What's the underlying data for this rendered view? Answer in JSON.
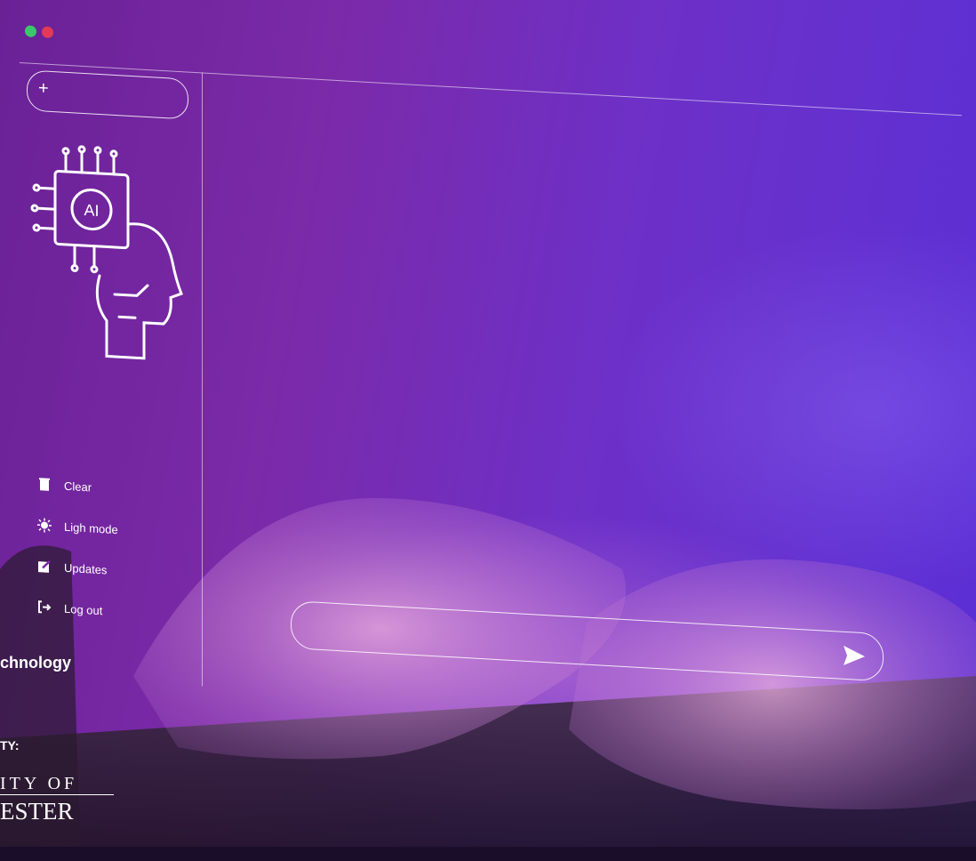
{
  "window": {
    "controls": [
      "green-dot",
      "red-dot"
    ],
    "new_chat_label": "+"
  },
  "sidebar": {
    "items": [
      {
        "label": "Clear",
        "icon": "trash-icon"
      },
      {
        "label": "Ligh mode",
        "icon": "sun-icon"
      },
      {
        "label": "Updates",
        "icon": "edit-icon"
      },
      {
        "label": "Log out",
        "icon": "logout-icon"
      }
    ],
    "art_icon_text": "AI"
  },
  "chat": {
    "input_placeholder": "",
    "send_icon": "send-icon"
  },
  "overlay": {
    "caption": "chnology",
    "caption2": "TY:",
    "university_line1": "ITY OF",
    "university_line2": "ESTER"
  },
  "colors": {
    "accent": "#7b2aa8",
    "window_line": "#ffffff",
    "green_dot": "#39c96b",
    "red_dot": "#e23a57"
  }
}
